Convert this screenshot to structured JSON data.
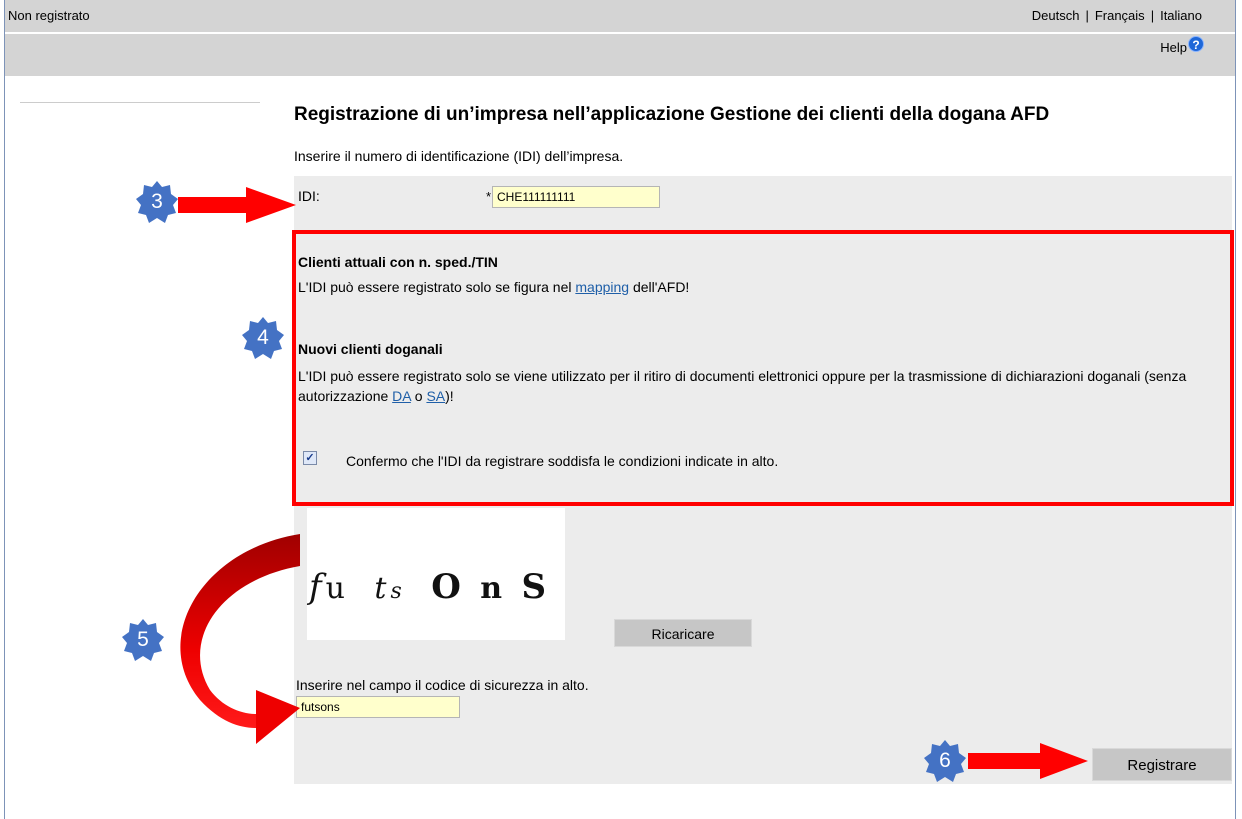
{
  "header": {
    "status": "Non registrato",
    "languages": [
      "Deutsch",
      "Français",
      "Italiano"
    ],
    "language_separator": "|",
    "help_label": "Help",
    "help_icon_glyph": "?"
  },
  "page": {
    "title": "Registrazione di un’impresa nell’applicazione Gestione dei clienti della dogana AFD",
    "intro": "Inserire il numero di identificazione (IDI) dell’impresa."
  },
  "form": {
    "idi_label": "IDI:",
    "required_mark": "*",
    "idi_value": "CHE111111111",
    "clients_heading": "Clienti attuali con n. sped./TIN",
    "clients_text_before": "L'IDI può essere registrato solo se figura nel ",
    "mapping_link": "mapping",
    "clients_text_after": " dell'AFD!",
    "new_heading": "Nuovi clienti doganali",
    "new_text_before": "L'IDI può essere registrato solo se viene utilizzato per il ritiro di documenti elettronici oppure per la trasmissione di dichiarazioni doganali (senza autorizzazione ",
    "da_link": "DA",
    "or_word": " o ",
    "sa_link": "SA",
    "new_text_after": ")!",
    "confirm_checked": true,
    "confirm_label": "Confermo che l'IDI da registrare soddisfa le condizioni indicate in alto.",
    "captcha_text": "fu ts O n S",
    "reload_label": "Ricaricare",
    "captcha_prompt": "Inserire nel campo il codice di sicurezza in alto.",
    "captcha_value": "futsons",
    "register_label": "Registrare"
  },
  "annotations": {
    "step3": "3",
    "step4": "4",
    "step5": "5",
    "step6": "6",
    "badge_color": "#4472c4",
    "arrow_color": "#ff0000"
  }
}
